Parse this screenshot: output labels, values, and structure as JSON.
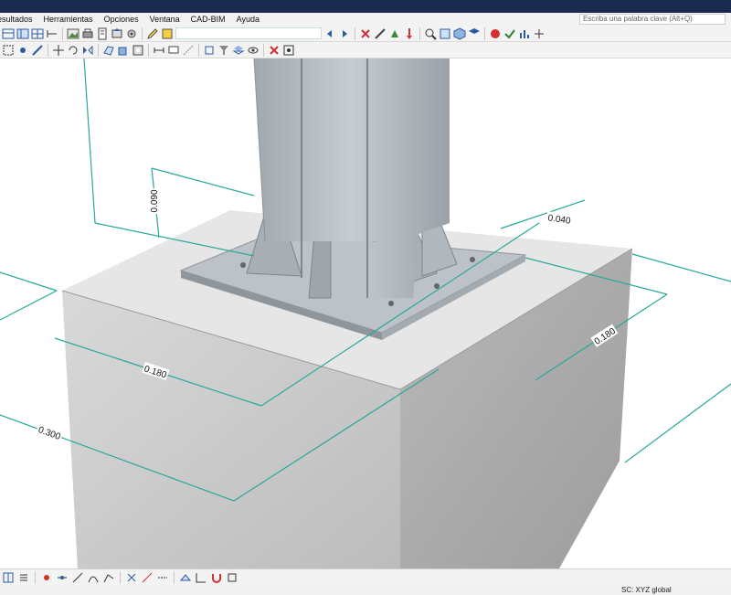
{
  "menu": {
    "items": [
      {
        "label": "esultados"
      },
      {
        "label": "Herramientas"
      },
      {
        "label": "Opciones"
      },
      {
        "label": "Ventana"
      },
      {
        "label": "CAD-BIM"
      },
      {
        "label": "Ayuda"
      }
    ]
  },
  "search": {
    "placeholder": "Escriba una palabra clave (Alt+Q)"
  },
  "dimensions": {
    "column_height": "0.090",
    "stiffener_offset": "0.040",
    "plate_width": "0.180",
    "plate_depth": "0.180",
    "footing_width": "0.300"
  },
  "status": {
    "coordinate_system": "SC: XYZ global"
  },
  "colors": {
    "dimension_line": "#2aa79b",
    "concrete": "#c9c9c9",
    "steel": "#a9b0b6",
    "titlebar": "#1b2a4f"
  }
}
